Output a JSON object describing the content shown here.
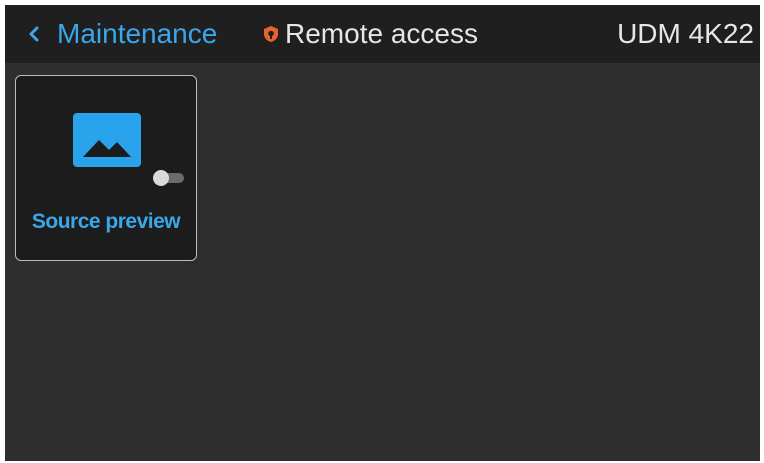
{
  "header": {
    "back_label": "Maintenance",
    "remote_access_label": "Remote access",
    "device_title": "UDM 4K22"
  },
  "tiles": [
    {
      "label": "Source preview",
      "icon": "image-icon",
      "toggle_on": false
    }
  ],
  "colors": {
    "accent": "#3aa7e8",
    "warning": "#e8632e",
    "background": "#2e2e2e",
    "topbar": "#1f1f1f",
    "text": "#e6e6e6"
  }
}
